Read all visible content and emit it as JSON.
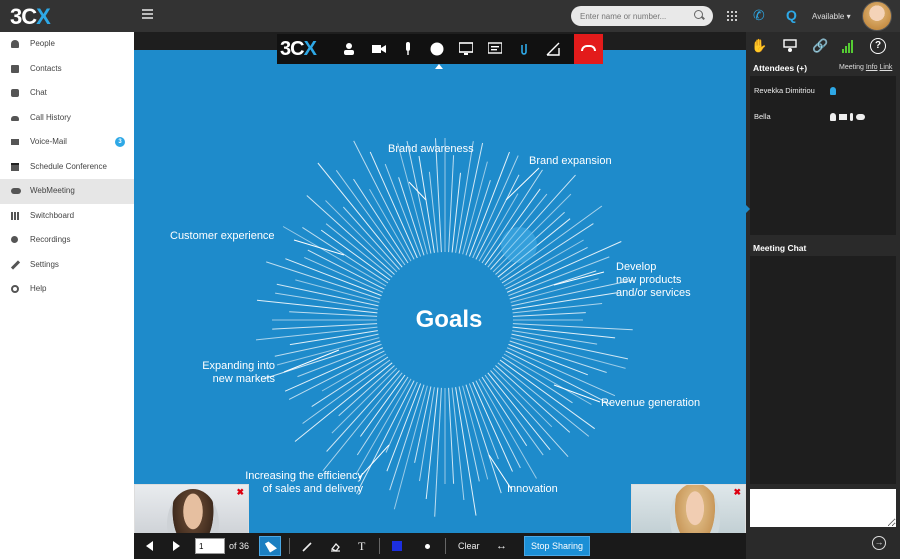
{
  "app": {
    "logo_left": "3C",
    "logo_right": "X"
  },
  "topbar": {
    "search_placeholder": "Enter name or number...",
    "status_label": "Available",
    "status_caret": "▾",
    "phone_glyph": "✆",
    "q_glyph": "Q"
  },
  "sidebar": {
    "items": [
      {
        "label": "People",
        "icon": "person-icon"
      },
      {
        "label": "Contacts",
        "icon": "contacts-icon"
      },
      {
        "label": "Chat",
        "icon": "chat-icon"
      },
      {
        "label": "Call History",
        "icon": "call-history-icon"
      },
      {
        "label": "Voice-Mail",
        "icon": "voicemail-icon",
        "badge": "3"
      },
      {
        "label": "Schedule Conference",
        "icon": "calendar-icon"
      },
      {
        "label": "WebMeeting",
        "icon": "webmeeting-icon",
        "active": true
      },
      {
        "label": "Switchboard",
        "icon": "switchboard-icon"
      },
      {
        "label": "Recordings",
        "icon": "recordings-icon"
      },
      {
        "label": "Settings",
        "icon": "wrench-icon"
      },
      {
        "label": "Help",
        "icon": "help-icon"
      }
    ]
  },
  "slide": {
    "center_title": "Goals",
    "labels": {
      "brand_awareness": "Brand awareness",
      "brand_expansion": "Brand expansion",
      "customer_experience": "Customer experience",
      "develop": "Develop\nnew products\nand/or services",
      "expanding": "Expanding into\nnew markets",
      "revenue": "Revenue generation",
      "efficiency": "Increasing the efficiency\nof sales and delivery",
      "innovation": "Innovation"
    }
  },
  "toolbar": {
    "logo_left": "3C",
    "logo_right": "X"
  },
  "videos": {
    "close_glyph": "✖",
    "lang_glyph": "G"
  },
  "controls": {
    "page_value": "1",
    "page_of": "of 36",
    "text_tool_glyph": "T",
    "clear_label": "Clear",
    "swap_glyph": "↔",
    "stop_sharing_label": "Stop Sharing"
  },
  "rightpanel": {
    "hand_glyph": "✋",
    "link_glyph": "🔗",
    "help_glyph": "?",
    "attendees_title": "Attendees (+)",
    "meeting_label": "Meeting",
    "info_label": "Info",
    "link_label": "Link",
    "attendees": [
      {
        "name": "Revekka Dimitriou"
      },
      {
        "name": "Bella"
      }
    ],
    "chat_title": "Meeting Chat",
    "send_glyph": "→"
  },
  "colors": {
    "accent": "#2ea8e6",
    "slide_bg": "#1e8bcb",
    "hangup": "#e31b1b",
    "signal": "#55cc33"
  }
}
